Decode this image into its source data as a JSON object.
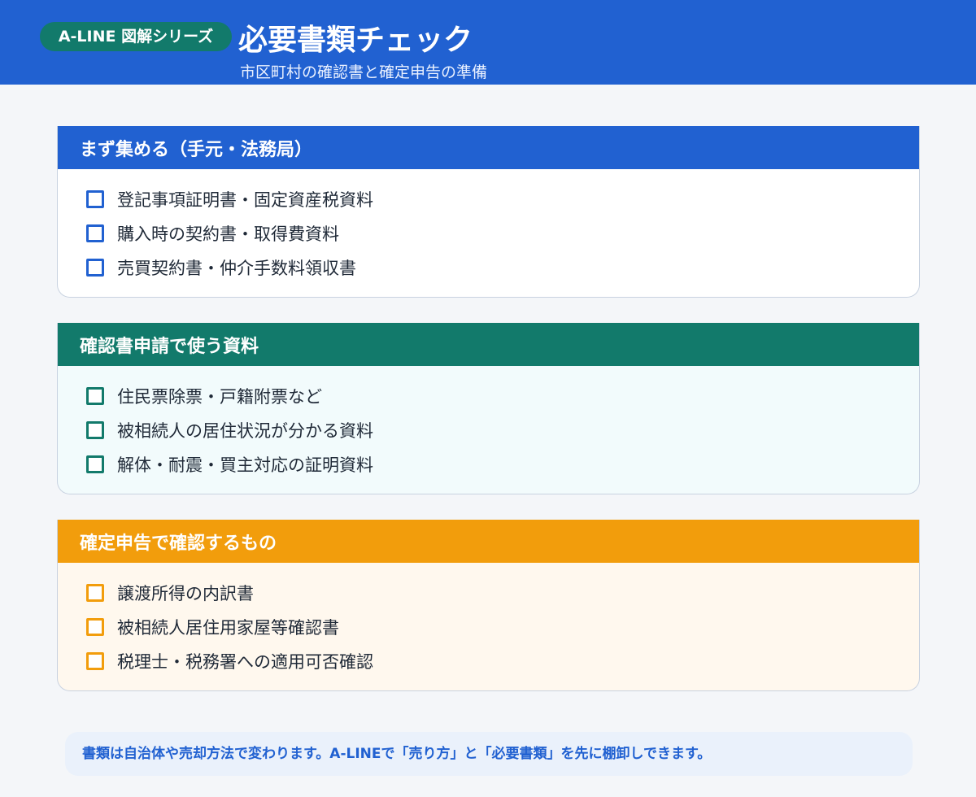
{
  "header": {
    "badge": "A-LINE 図解シリーズ",
    "title": "必要書類チェック",
    "subtitle": "市区町村の確認書と確定申告の準備"
  },
  "sections": [
    {
      "title": "まず集める（手元・法務局）",
      "items": [
        "登記事項証明書・固定資産税資料",
        "購入時の契約書・取得費資料",
        "売買契約書・仲介手数料領収書"
      ]
    },
    {
      "title": "確認書申請で使う資料",
      "items": [
        "住民票除票・戸籍附票など",
        "被相続人の居住状況が分かる資料",
        "解体・耐震・買主対応の証明資料"
      ]
    },
    {
      "title": "確定申告で確認するもの",
      "items": [
        "譲渡所得の内訳書",
        "被相続人居住用家屋等確認書",
        "税理士・税務署への適用可否確認"
      ]
    }
  ],
  "footer": {
    "note": "書類は自治体や売却方法で変わります。A-LINEで「売り方」と「必要書類」を先に棚卸しできます。"
  },
  "colors": {
    "blue": "#2161d1",
    "green": "#127a6b",
    "orange": "#f29d0c",
    "background": "#f4f6f9"
  }
}
